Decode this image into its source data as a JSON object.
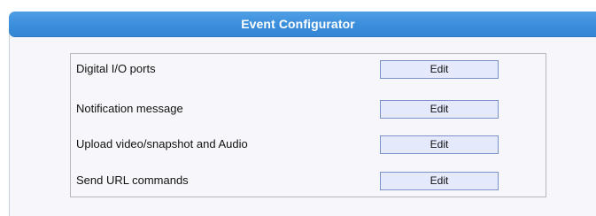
{
  "panel": {
    "title": "Event Configurator"
  },
  "rows": [
    {
      "label": "Digital I/O ports",
      "button_label": "Edit"
    },
    {
      "label": "Notification message",
      "button_label": "Edit"
    },
    {
      "label": "Upload video/snapshot and Audio",
      "button_label": "Edit"
    },
    {
      "label": "Send URL commands",
      "button_label": "Edit"
    }
  ],
  "colors": {
    "header_blue": "#3b8edb",
    "panel_background": "#f7f7fb",
    "button_background": "#e4e9fb",
    "button_border": "#7b92c9"
  }
}
